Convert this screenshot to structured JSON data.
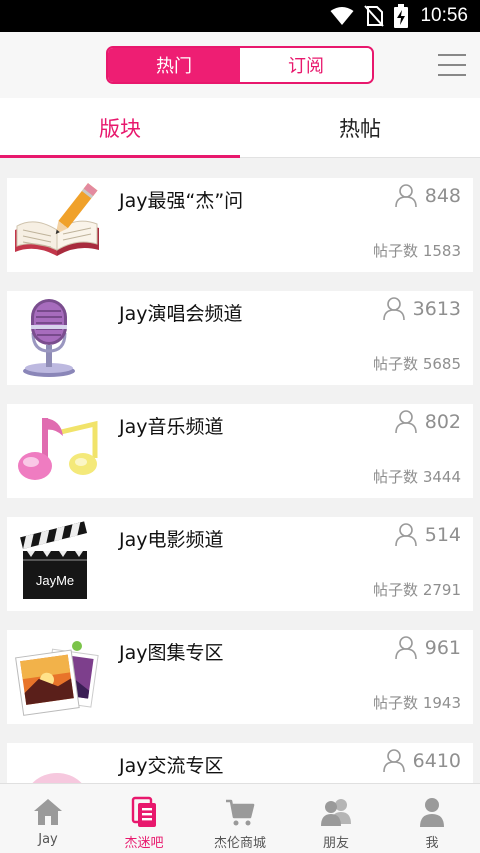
{
  "status_bar": {
    "time": "10:56",
    "icons": [
      "wifi-icon",
      "no-sim-icon",
      "battery-charging-icon"
    ]
  },
  "header": {
    "segments": [
      "热门",
      "订阅"
    ],
    "active_segment": "热门",
    "menu_icon": "hamburger-menu-icon"
  },
  "subtabs": [
    "版块",
    "热帖"
  ],
  "active_subtab": "版块",
  "colors": {
    "accent": "#e8186d",
    "segment_active": "#ee1e73",
    "text_gray": "#8f8f8f"
  },
  "forums": [
    {
      "title": "Jay最强“杰”问",
      "users": "848",
      "posts": "帖子数 1583",
      "icon": "book-pencil-icon"
    },
    {
      "title": "Jay演唱会频道",
      "users": "3613",
      "posts": "帖子数 5685",
      "icon": "microphone-icon"
    },
    {
      "title": "Jay音乐频道",
      "users": "802",
      "posts": "帖子数 3444",
      "icon": "music-notes-icon"
    },
    {
      "title": "Jay电影频道",
      "users": "514",
      "posts": "帖子数 2791",
      "icon": "clapperboard-icon",
      "icon_text": "JayMe"
    },
    {
      "title": "Jay图集专区",
      "users": "961",
      "posts": "帖子数 1943",
      "icon": "photo-album-icon"
    },
    {
      "title": "Jay交流专区",
      "users": "6410",
      "posts": "",
      "icon": "chat-bubble-icon"
    }
  ],
  "bottom_nav": [
    {
      "label": "Jay",
      "icon": "home-icon"
    },
    {
      "label": "杰迷吧",
      "icon": "forum-icon"
    },
    {
      "label": "杰伦商城",
      "icon": "cart-icon"
    },
    {
      "label": "朋友",
      "icon": "friends-icon"
    },
    {
      "label": "我",
      "icon": "profile-icon"
    }
  ],
  "active_nav": "杰迷吧"
}
